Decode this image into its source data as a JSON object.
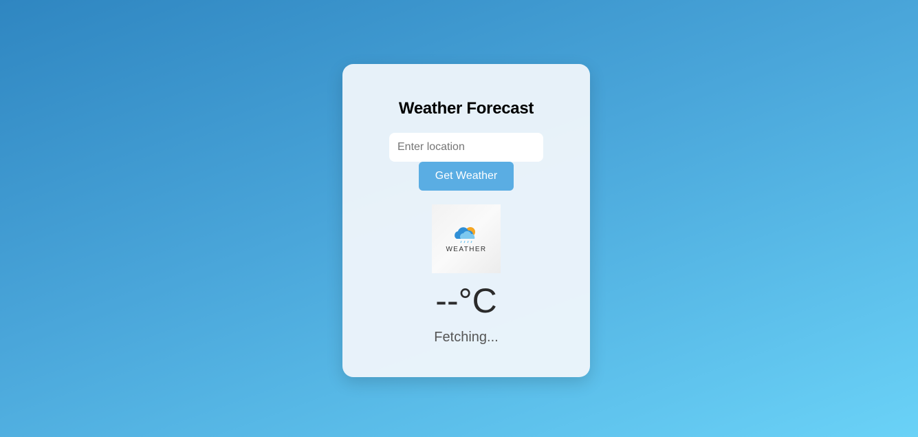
{
  "card": {
    "title": "Weather Forecast",
    "location_input": {
      "value": "",
      "placeholder": "Enter location"
    },
    "get_weather_label": "Get Weather",
    "weather_image": {
      "icon": "cloud-sun-rain-icon",
      "label": "WEATHER"
    },
    "temperature": "--°C",
    "status": "Fetching..."
  },
  "colors": {
    "background_start": "#2f86c1",
    "background_end": "#6ad2f7",
    "button": "#5aade3"
  }
}
